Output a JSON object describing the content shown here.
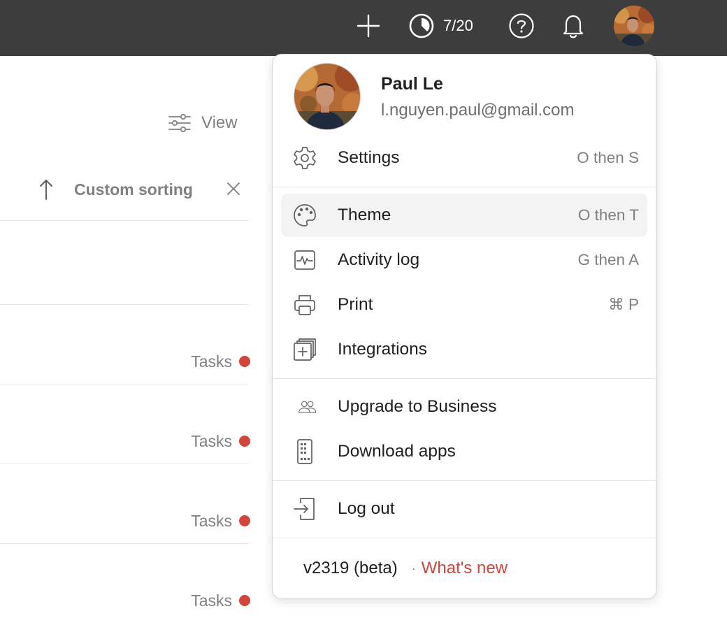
{
  "topbar": {
    "karma_count": "7/20",
    "icons": [
      "plus-icon",
      "productivity-icon",
      "help-icon",
      "bell-icon",
      "avatar"
    ]
  },
  "background": {
    "view_label": "View",
    "sort_label": "Custom sorting",
    "task_tags": [
      "Tasks",
      "Tasks",
      "Tasks",
      "Tasks"
    ]
  },
  "menu": {
    "profile": {
      "name": "Paul Le",
      "email": "l.nguyen.paul@gmail.com"
    },
    "items": [
      {
        "label": "Settings",
        "shortcut": "O then S",
        "icon": "gear-icon"
      },
      {
        "label": "Theme",
        "shortcut": "O then T",
        "icon": "palette-icon"
      },
      {
        "label": "Activity log",
        "shortcut": "G then A",
        "icon": "activity-icon"
      },
      {
        "label": "Print",
        "shortcut": "⌘ P",
        "icon": "printer-icon"
      },
      {
        "label": "Integrations",
        "shortcut": "",
        "icon": "integrations-icon"
      },
      {
        "label": "Upgrade to Business",
        "shortcut": "",
        "icon": "people-icon"
      },
      {
        "label": "Download apps",
        "shortcut": "",
        "icon": "phone-icon"
      },
      {
        "label": "Log out",
        "shortcut": "",
        "icon": "logout-icon"
      }
    ],
    "footer": {
      "version": "v2319 (beta)",
      "separator": "·",
      "whats_new": "What's new"
    }
  },
  "colors": {
    "topbar_bg": "#3d3d3d",
    "accent_red": "#d1453b",
    "hover_bg": "#f3f3f3"
  }
}
